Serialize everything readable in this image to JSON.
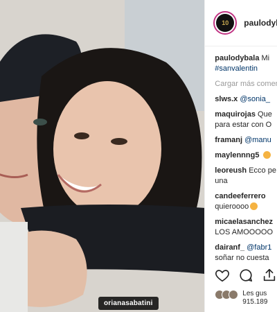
{
  "header": {
    "username": "paulodybala",
    "avatar_text": "10"
  },
  "photo": {
    "tag": "orianasabatini"
  },
  "caption": {
    "user": "paulodybala",
    "text": "Mi",
    "hashtag": "#sanvalentin"
  },
  "load_more": "Cargar más comen",
  "comments": [
    {
      "user": "slws.x",
      "mention": "@sonia_",
      "text": ""
    },
    {
      "user": "maquirojas",
      "text": "Que",
      "line2": "para estar con O"
    },
    {
      "user": "framanj",
      "mention": "@manu",
      "text": ""
    },
    {
      "user": "maylennng5",
      "text": "",
      "emoji": true
    },
    {
      "user": "leoreush",
      "text": "Ecco pe",
      "line2": "una"
    },
    {
      "user": "candeeferrero",
      "text": "",
      "line2": "quieroooo"
    },
    {
      "user": "micaelasanchez",
      "text": "",
      "line2": "LOS AMOOOOO"
    },
    {
      "user": "dairanf_",
      "mention": "@fabr1",
      "text": "",
      "line2": "soñar no cuesta"
    }
  ],
  "likes": {
    "line1": "Les gus",
    "line2": "915.189"
  },
  "colors": {
    "link": "#003569",
    "muted": "#999999",
    "ring": "#c13584"
  }
}
